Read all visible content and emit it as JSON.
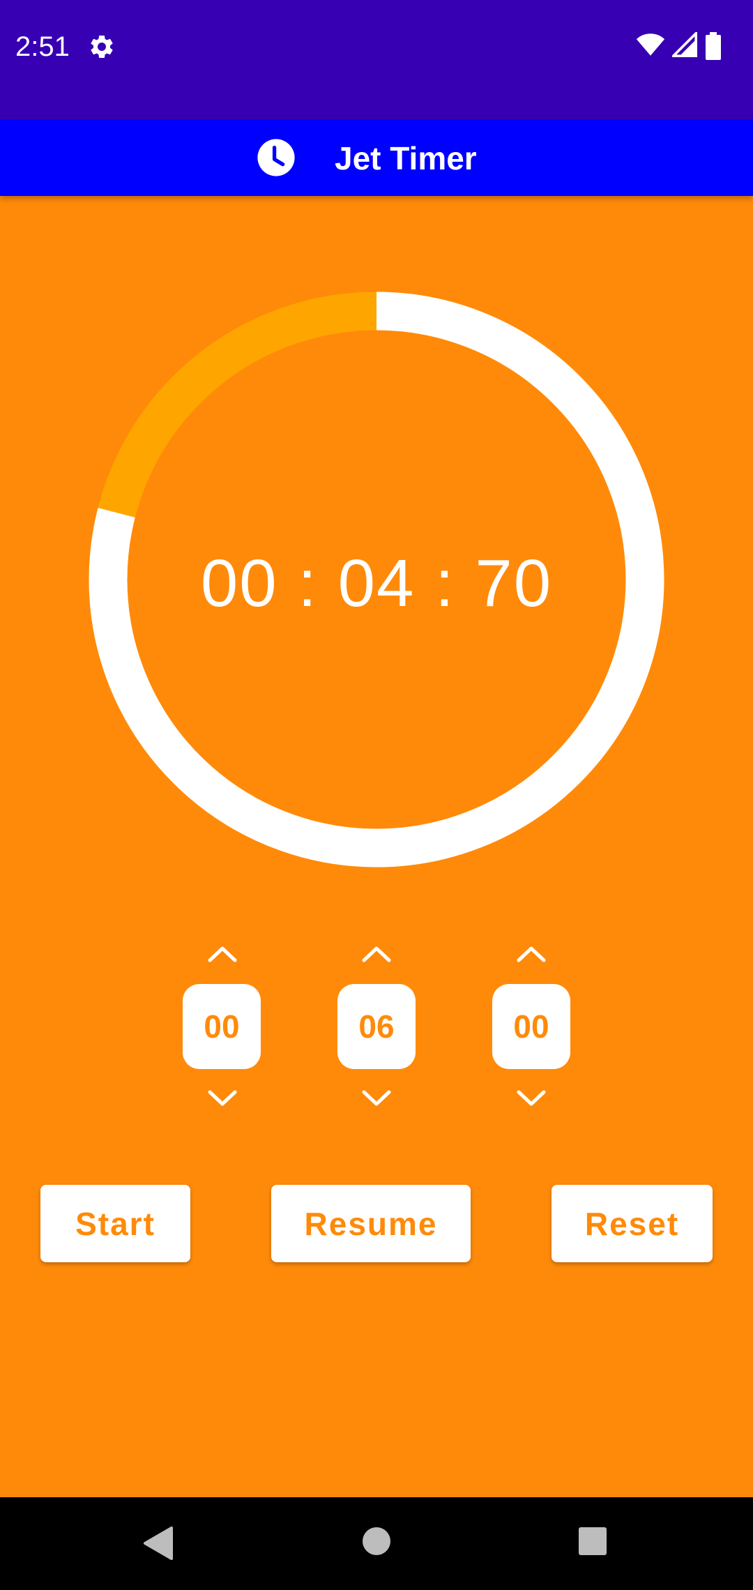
{
  "status_bar": {
    "time": "2:51",
    "icons": [
      "gear-icon",
      "wifi-icon",
      "signal-icon",
      "battery-icon"
    ]
  },
  "app_bar": {
    "icon": "clock-icon",
    "title": "Jet Timer"
  },
  "timer": {
    "display": "00 : 04 : 70",
    "progress_remaining_fraction": 0.79
  },
  "pickers": [
    {
      "value": "00"
    },
    {
      "value": "06"
    },
    {
      "value": "00"
    }
  ],
  "buttons": {
    "start": "Start",
    "resume": "Resume",
    "reset": "Reset"
  },
  "colors": {
    "background": "#FF8A09",
    "status_bar": "#3700B3",
    "app_bar": "#0000FF",
    "ring_track": "#FFA500",
    "ring_progress": "#FFFFFF"
  },
  "nav_bar": {
    "icons": [
      "back-icon",
      "home-icon",
      "recents-icon"
    ]
  }
}
